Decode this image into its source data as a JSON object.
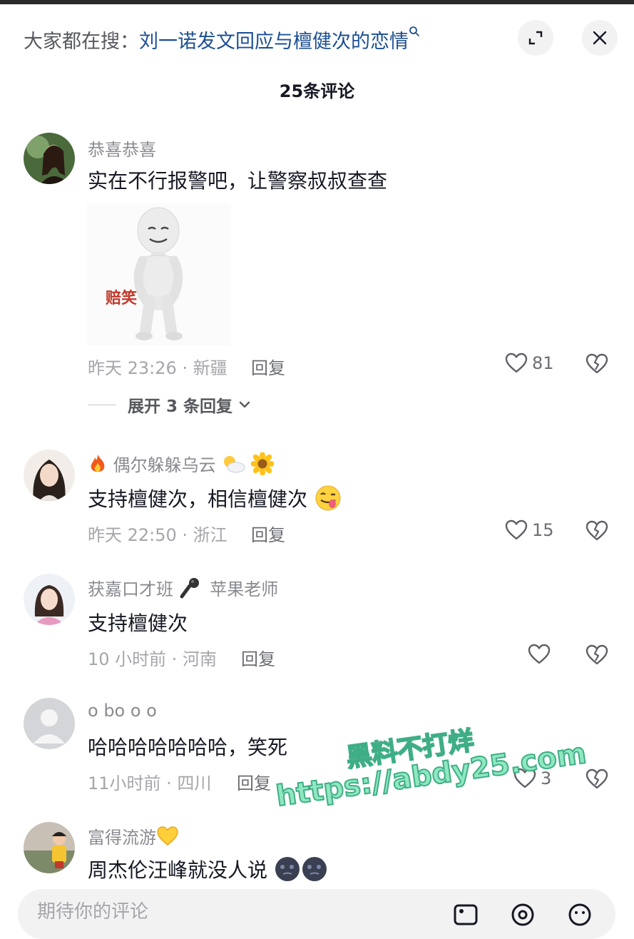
{
  "header": {
    "search_prefix": "大家都在搜：",
    "search_query": "刘一诺发文回应与檀健次的恋情",
    "comment_count": "25条评论"
  },
  "comments": [
    {
      "username": "恭喜恭喜",
      "text": "实在不行报警吧，让警察叔叔查查",
      "sticker_caption": "赔笑",
      "meta": "昨天 23:26 · 新疆",
      "reply_label": "回复",
      "likes": "81",
      "expand_replies": "展开 3 条回复"
    },
    {
      "username": "偶尔躲躲乌云",
      "text": "支持檀健次，相信檀健次",
      "meta": "昨天 22:50 · 浙江",
      "reply_label": "回复",
      "likes": "15"
    },
    {
      "username": "获嘉口才班",
      "username_suffix": "苹果老师",
      "text": "支持檀健次",
      "meta": "10 小时前 · 河南",
      "reply_label": "回复",
      "likes": ""
    },
    {
      "username": "o bo o o",
      "text": "哈哈哈哈哈哈哈，笑死",
      "meta": "11小时前 · 四川",
      "reply_label": "回复",
      "likes": "3"
    },
    {
      "username": "富得流游",
      "text": "周杰伦汪峰就没人说"
    }
  ],
  "watermark": {
    "line1": "黑料不打烊",
    "line2": "https://abdy25.com"
  },
  "input": {
    "placeholder": "期待你的评论"
  },
  "colors": {
    "link": "#1d4f91",
    "muted": "#8a8b91",
    "text": "#161823",
    "watermark": "#8fe8c0"
  }
}
